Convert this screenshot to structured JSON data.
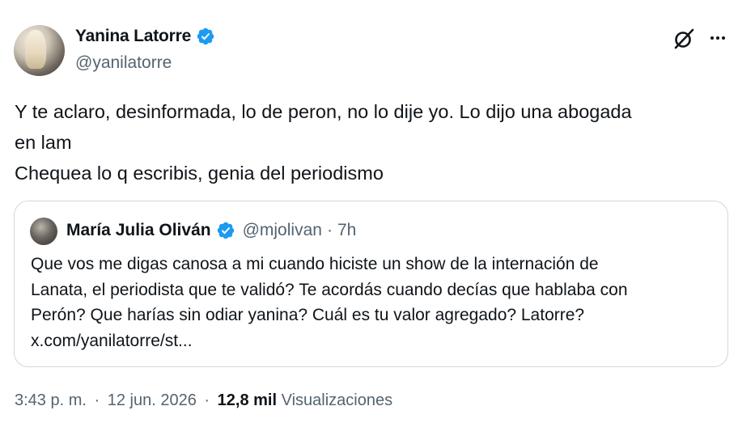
{
  "author": {
    "name": "Yanina Latorre",
    "handle": "@yanilatorre"
  },
  "icons": {
    "verified": "verified-badge-icon",
    "grok": "grok-icon",
    "more": "more-options-icon",
    "verified_color": "#1d9bf0"
  },
  "tweet": {
    "lines": [
      "Y te aclaro, desinformada, lo de peron, no lo dije yo. Lo dijo una abogada",
      "en lam",
      "Chequea lo q escribis, genia del periodismo"
    ]
  },
  "quote": {
    "name": "María Julia Oliván",
    "handle": "@mjolivan",
    "separator": "·",
    "time": "7h",
    "lines": [
      "Que vos me digas canosa a mi cuando hiciste un show de la internación de",
      "Lanata, el periodista que te validó? Te acordás cuando decías que hablaba con",
      "Perón? Que harías sin odiar yanina? Cuál es tu valor agregado? Latorre?",
      "x.com/yanilatorre/st..."
    ]
  },
  "footer": {
    "time": "3:43 p. m.",
    "separator": "·",
    "date": "12 jun. 2026",
    "views_count": "12,8 mil",
    "views_label": "Visualizaciones"
  }
}
